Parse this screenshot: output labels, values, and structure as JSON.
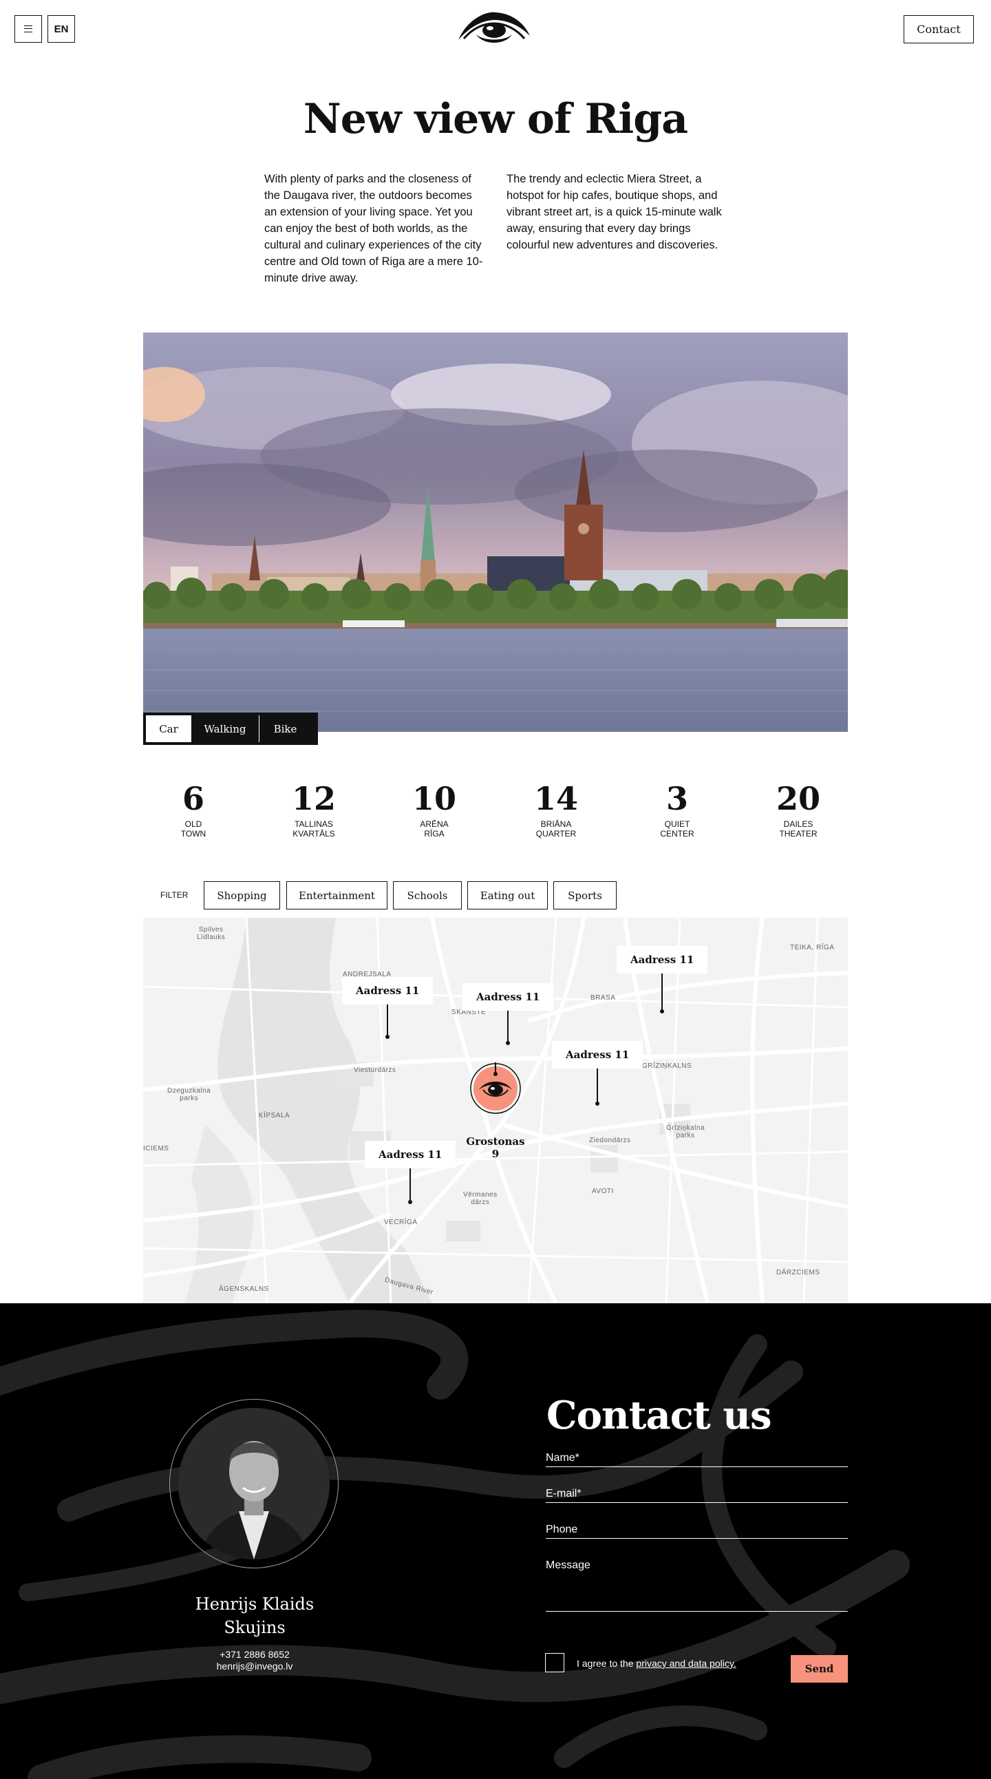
{
  "header": {
    "lang": "EN",
    "contact_label": "Contact"
  },
  "hero": {
    "title": "New view of Riga",
    "intro_left": "With plenty of parks and the closeness of the Daugava river, the outdoors becomes an extension of your living space. Yet you can enjoy the best of both worlds, as the cultural and culinary experiences of the city centre and Old town of Riga are a mere 10-minute drive away.",
    "intro_right": "The trendy and eclectic Miera Street, a hotspot for hip cafes, boutique shops, and vibrant street art, is a quick 15-minute walk away, ensuring that every day brings colourful new adventures and discoveries."
  },
  "transport_modes": [
    "Car",
    "Walking",
    "Bike"
  ],
  "active_mode": "Car",
  "stats": [
    {
      "value": "6",
      "label": "OLD\nTOWN"
    },
    {
      "value": "12",
      "label": "TALLINAS\nKVARTĀLS"
    },
    {
      "value": "10",
      "label": "ARĒNA\nRĪGA"
    },
    {
      "value": "14",
      "label": "BRIĀNA\nQUARTER"
    },
    {
      "value": "3",
      "label": "QUIET\nCENTER"
    },
    {
      "value": "20",
      "label": "DAILES\nTHEATER"
    }
  ],
  "filter": {
    "label": "FILTER",
    "options": [
      "Shopping",
      "Entertainment",
      "Schools",
      "Eating out",
      "Sports"
    ]
  },
  "map": {
    "home_address": "Grostonas 9",
    "pins": [
      "Aadress 11",
      "Aadress 11",
      "Aadress 11",
      "Aadress 11",
      "Aadress 11"
    ],
    "labels": {
      "spilves": "Spilves\nLīdlauks",
      "andrejsala": "ANDREJSALA",
      "skanste": "SKANSTE",
      "brasa": "BRASA",
      "teika": "TEIKA, RĪGA",
      "grizinkalns": "GRĪZIŅKALNS",
      "kipsala": "ĶĪPSALA",
      "dzeguzkalna": "Dzeguzkalna\nparks",
      "viesturdarzs": "Viesturdārzs",
      "vermanes": "Vērmanes\ndārzs",
      "vecriga": "VECRĪGA",
      "avoti": "AVOTI",
      "agenskalns": "ĀGENSKALNS",
      "darzciems": "DĀRZCIEMS",
      "iecems": "ICIEMS",
      "ziedondarzs": "Ziedondārzs",
      "grizinkalna_parks": "Grīziņkalna\nparks",
      "daugava": "Daugava River"
    }
  },
  "contact": {
    "title": "Contact us",
    "agent_name": "Henrijs Klaids\nSkujins",
    "phone": "+371 2886 8652",
    "email": "henrijs@invego.lv",
    "fields": {
      "name": "Name*",
      "email": "E-mail*",
      "phone": "Phone",
      "message": "Message"
    },
    "agree_text": "I agree to the ",
    "agree_link": "privacy and data policy.",
    "send_label": "Send",
    "accent": "#f7937c"
  }
}
